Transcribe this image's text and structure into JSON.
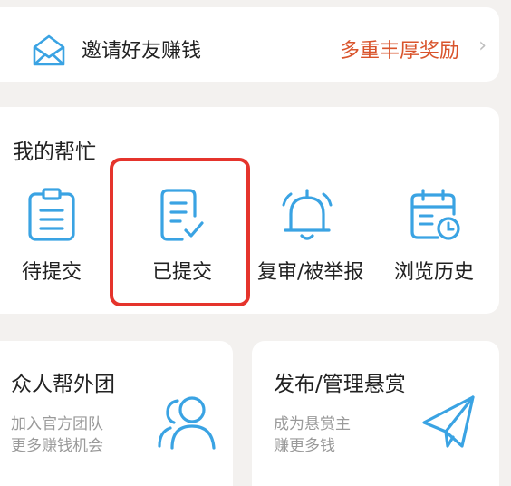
{
  "invite": {
    "label": "邀请好友赚钱",
    "promo": "多重丰厚奖励",
    "icon": "envelope-icon"
  },
  "my_help": {
    "title": "我的帮忙",
    "items": [
      {
        "label": "待提交",
        "icon": "clipboard-list-icon"
      },
      {
        "label": "已提交",
        "icon": "document-check-icon",
        "highlighted": true
      },
      {
        "label": "复审/被举报",
        "icon": "bell-icon"
      },
      {
        "label": "浏览历史",
        "icon": "calendar-clock-icon"
      }
    ]
  },
  "tiles": [
    {
      "title": "众人帮外团",
      "sub_line1": "加入官方团队",
      "sub_line2": "更多赚钱机会",
      "icon": "users-icon"
    },
    {
      "title": "发布/管理悬赏",
      "sub_line1": "成为悬赏主",
      "sub_line2": "赚更多钱",
      "icon": "paper-plane-icon"
    }
  ],
  "colors": {
    "accent_blue": "#3aa3e3",
    "promo_red": "#d9542c",
    "highlight_red": "#e5342c"
  }
}
